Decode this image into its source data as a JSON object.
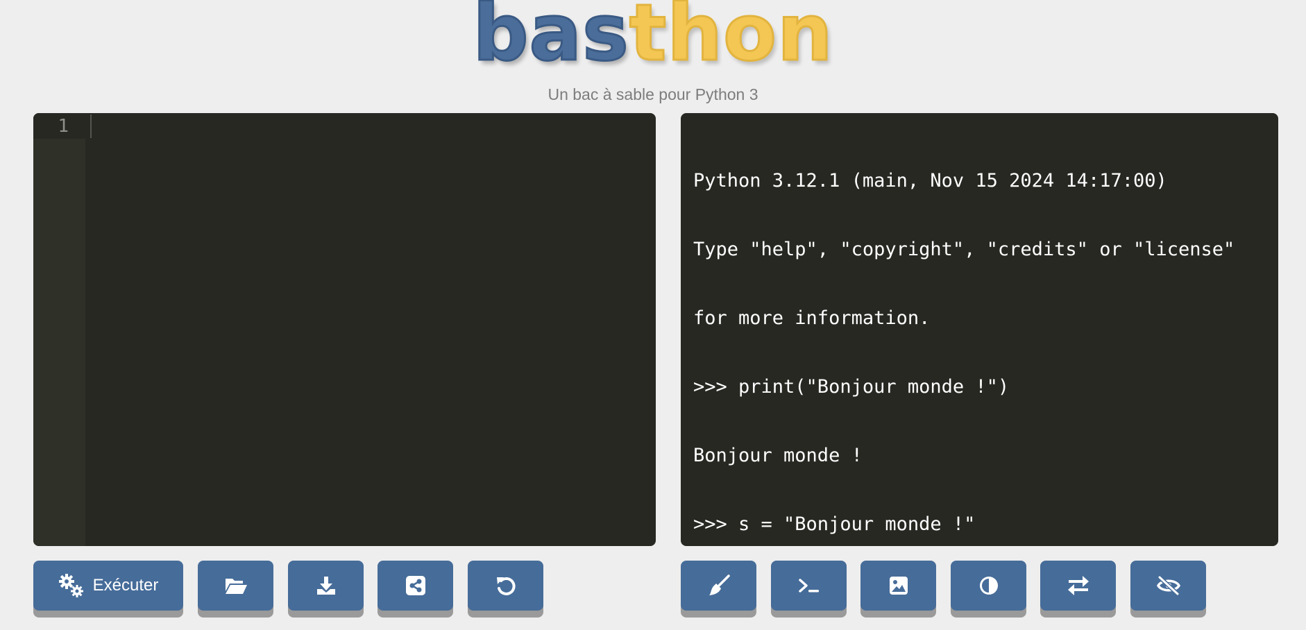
{
  "header": {
    "logo_part1": "bas",
    "logo_part2": "thon",
    "subtitle": "Un bac à sable pour Python 3"
  },
  "editor": {
    "line_numbers": [
      "1"
    ],
    "content": ""
  },
  "console": {
    "lines": [
      "Python 3.12.1 (main, Nov 15 2024 14:17:00)",
      "Type \"help\", \"copyright\", \"credits\" or \"license\"",
      "for more information.",
      ">>> print(\"Bonjour monde !\")",
      "Bonjour monde !",
      ">>> s = \"Bonjour monde !\""
    ],
    "prompt": ">>> "
  },
  "toolbar_left": {
    "run_label": "Exécuter",
    "buttons": [
      {
        "icon": "gears-icon",
        "label": "Exécuter"
      },
      {
        "icon": "folder-open-icon"
      },
      {
        "icon": "download-icon"
      },
      {
        "icon": "share-icon"
      },
      {
        "icon": "undo-icon"
      }
    ]
  },
  "toolbar_right": {
    "buttons": [
      {
        "icon": "broom-icon"
      },
      {
        "icon": "terminal-icon"
      },
      {
        "icon": "image-icon"
      },
      {
        "icon": "contrast-icon"
      },
      {
        "icon": "swap-arrows-icon"
      },
      {
        "icon": "eye-slash-icon"
      }
    ]
  },
  "colors": {
    "background": "#eeeeee",
    "panel": "#272822",
    "gutter": "#2f3129",
    "button": "#466c99",
    "button_shadow": "#9a9a9a",
    "logo_blue": "#4a6d9a",
    "logo_yellow": "#f4c653"
  }
}
